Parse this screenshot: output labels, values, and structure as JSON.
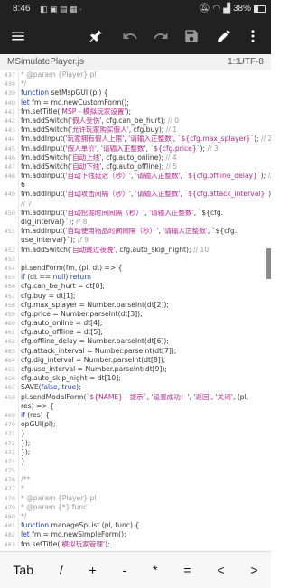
{
  "status": {
    "time": "8:46",
    "battery": "38%",
    "battery_level": 0.38
  },
  "toolbar": {
    "menu_icon": "menu-icon",
    "pin_icon": "pin-icon",
    "undo_icon": "undo-icon",
    "redo_icon": "redo-icon",
    "save_icon": "save-icon",
    "edit_icon": "pencil-icon",
    "more_icon": "more-vert-icon"
  },
  "file": {
    "name": "MSimulatePlayer.js",
    "position": "1:1",
    "encoding": "UTF-8"
  },
  "editor": {
    "lines": [
      {
        "n": "437",
        "t": " * @param {Player} pl"
      },
      {
        "n": "438",
        "t": " */"
      },
      {
        "n": "439",
        "t": "function setMspGUI (pl) {"
      },
      {
        "n": "440",
        "t": "    let fm = mc.newCustomForm();"
      },
      {
        "n": "441",
        "t": "    fm.setTitle('MSP - 模拟玩家设置');"
      },
      {
        "n": "442",
        "t": "    fm.addSwitch('假人受伤', cfg.can_be_hurt); // 0"
      },
      {
        "n": "443",
        "t": "    fm.addSwitch('允许玩家购买假人', cfg.buy); // 1"
      },
      {
        "n": "444",
        "t": "    fm.addInput('玩家拥有假人上限', '请输入正整数', `${cfg.max_splayer}`); // 2"
      },
      {
        "n": "445",
        "t": "    fm.addInput('假人单价', '请输入正整数', `${cfg.price}`); // 3"
      },
      {
        "n": "446",
        "t": "    fm.addSwitch('自动上线', cfg.auto_online); // 4"
      },
      {
        "n": "447",
        "t": "    fm.addSwitch('自动下线', cfg.auto_offline); // 5"
      },
      {
        "n": "448",
        "t": "    fm.addInput('自动下线延迟（秒）', '请输入正整数', `${cfg.offline_delay}`); //"
      },
      {
        "n": "",
        "t": " 6"
      },
      {
        "n": "449",
        "t": "    fm.addInput('自动攻击间隔（秒）', '请输入正整数', `${cfg.attack_interval}`);"
      },
      {
        "n": "",
        "t": " // 7"
      },
      {
        "n": "450",
        "t": "    fm.addInput('自动挖掘时间间隔（秒）', '请输入正整数', `${cfg."
      },
      {
        "n": "",
        "t": "dig_interval}`); // 8"
      },
      {
        "n": "451",
        "t": "    fm.addInput('自动使用物品时间间隔（秒）', '请输入正整数', `${cfg."
      },
      {
        "n": "",
        "t": "use_interval}`); // 9"
      },
      {
        "n": "452",
        "t": "    fm.addSwitch('自动跳过夜晚', cfg.auto_skip_night); // 10"
      },
      {
        "n": "453",
        "t": ""
      },
      {
        "n": "454",
        "t": "    pl.sendForm(fm, (pl, dt) => {"
      },
      {
        "n": "455",
        "t": "        if (dt == null) return"
      },
      {
        "n": "456",
        "t": "        cfg.can_be_hurt = dt[0];"
      },
      {
        "n": "457",
        "t": "        cfg.buy = dt[1];"
      },
      {
        "n": "458",
        "t": "        cfg.max_splayer = Number.parseInt(dt[2]);"
      },
      {
        "n": "459",
        "t": "        cfg.price = Number.parseInt(dt[3]);"
      },
      {
        "n": "460",
        "t": "        cfg.auto_online = dt[4];"
      },
      {
        "n": "461",
        "t": "        cfg.auto_offline = dt[5];"
      },
      {
        "n": "462",
        "t": "        cfg.offline_delay = Number.parseInt(dt[6]);"
      },
      {
        "n": "463",
        "t": "        cfg.attack_interval = Number.parseInt(dt[7]);"
      },
      {
        "n": "464",
        "t": "        cfg.dig_interval = Number.parseInt(dt[8]);"
      },
      {
        "n": "465",
        "t": "        cfg.use_interval = Number.parseInt(dt[9]);"
      },
      {
        "n": "466",
        "t": "        cfg.auto_skip_night = dt[10];"
      },
      {
        "n": "467",
        "t": "        SAVE(false, true);"
      },
      {
        "n": "468",
        "t": "        pl.sendModalForm(`${NAME} - 提示`, '设置成功！', '返回', '关闭', (pl,"
      },
      {
        "n": "",
        "t": "res) => {"
      },
      {
        "n": "469",
        "t": "            if (res) {"
      },
      {
        "n": "470",
        "t": "                opGUI(pl);"
      },
      {
        "n": "471",
        "t": "            }"
      },
      {
        "n": "472",
        "t": "        });"
      },
      {
        "n": "473",
        "t": "    });"
      },
      {
        "n": "474",
        "t": "}"
      },
      {
        "n": "475",
        "t": ""
      },
      {
        "n": "476",
        "t": "/**"
      },
      {
        "n": "477",
        "t": " *"
      },
      {
        "n": "478",
        "t": " * @param {Player} pl"
      },
      {
        "n": "479",
        "t": " * @param {*} func"
      },
      {
        "n": "480",
        "t": " */"
      },
      {
        "n": "481",
        "t": "function manageSpList (pl, func) {"
      },
      {
        "n": "482",
        "t": "    let fm = mc.newSimpleForm();"
      },
      {
        "n": "483",
        "t": "    fm.setTitle('模拟玩家管理');"
      }
    ]
  },
  "keys": [
    "Tab",
    "/",
    "+",
    "-",
    "*",
    "=",
    "<",
    ">"
  ]
}
